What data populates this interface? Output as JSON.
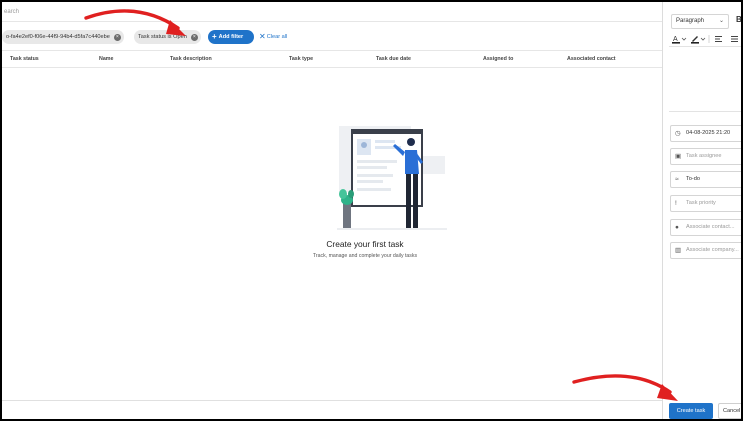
{
  "search": {
    "placeholder_text": "earch"
  },
  "filters": {
    "chip1_label": "o-fa4e2ef0-f06e-44f9-94b4-d5fa7c440ebe",
    "chip2_label": "Task status is Open",
    "add_filter_label": "Add filter",
    "clear_all_label": "Clear all"
  },
  "table": {
    "columns": [
      "Task status",
      "Name",
      "Task description",
      "Task type",
      "Task due date",
      "Assigned to",
      "Associated contact"
    ]
  },
  "empty_state": {
    "title": "Create your first task",
    "subtitle": "Track, manage and complete your daily tasks"
  },
  "panel": {
    "paragraph_label": "Paragraph",
    "bold_label": "B",
    "due_datetime": "04-08-2025 21:20",
    "assignees_placeholder": "Task assignee",
    "type_value": "To-do",
    "priority_placeholder": "Task priority",
    "contact_placeholder": "Associate contact...",
    "company_placeholder": "Associate company..."
  },
  "footer": {
    "create_label": "Create task",
    "cancel_label": "Cancel"
  },
  "colors": {
    "accent": "#1f73c9",
    "annotation": "#e02020"
  }
}
